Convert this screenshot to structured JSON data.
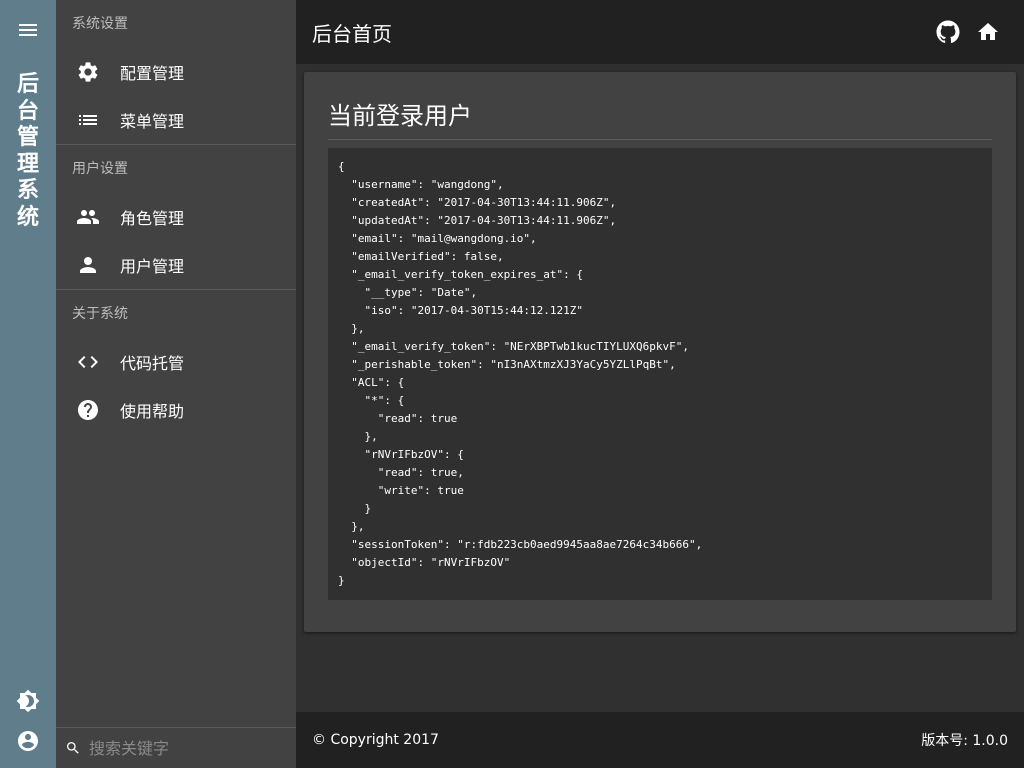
{
  "rail": {
    "title_chars": [
      "后",
      "台",
      "管",
      "理",
      "系",
      "统"
    ],
    "icons": [
      "menu-icon",
      "brightness-icon",
      "account-circle-icon"
    ]
  },
  "nav": {
    "sections": [
      {
        "label": "系统设置",
        "items": [
          {
            "label": "配置管理",
            "icon": "gear-icon"
          },
          {
            "label": "菜单管理",
            "icon": "list-icon"
          }
        ]
      },
      {
        "label": "用户设置",
        "items": [
          {
            "label": "角色管理",
            "icon": "group-icon"
          },
          {
            "label": "用户管理",
            "icon": "person-icon"
          }
        ]
      },
      {
        "label": "关于系统",
        "items": [
          {
            "label": "代码托管",
            "icon": "code-icon"
          },
          {
            "label": "使用帮助",
            "icon": "help-icon"
          }
        ]
      }
    ],
    "search": {
      "placeholder": "搜索关键字",
      "value": ""
    }
  },
  "topbar": {
    "title": "后台首页",
    "actions": [
      "github-icon",
      "home-icon"
    ]
  },
  "card": {
    "title": "当前登录用户",
    "code": "{\n  \"username\": \"wangdong\",\n  \"createdAt\": \"2017-04-30T13:44:11.906Z\",\n  \"updatedAt\": \"2017-04-30T13:44:11.906Z\",\n  \"email\": \"mail@wangdong.io\",\n  \"emailVerified\": false,\n  \"_email_verify_token_expires_at\": {\n    \"__type\": \"Date\",\n    \"iso\": \"2017-04-30T15:44:12.121Z\"\n  },\n  \"_email_verify_token\": \"NErXBPTwb1kucTIYLUXQ6pkvF\",\n  \"_perishable_token\": \"nI3nAXtmzXJ3YaCy5YZLlPqBt\",\n  \"ACL\": {\n    \"*\": {\n      \"read\": true\n    },\n    \"rNVrIFbzOV\": {\n      \"read\": true,\n      \"write\": true\n    }\n  },\n  \"sessionToken\": \"r:fdb223cb0aed9945aa8ae7264c34b666\",\n  \"objectId\": \"rNVrIFbzOV\"\n}"
  },
  "footer": {
    "copyright": "© Copyright 2017",
    "version": "版本号: 1.0.0"
  },
  "colors": {
    "rail": "#607d8b",
    "nav": "#424242",
    "topbar": "#212121",
    "background": "#303030"
  }
}
